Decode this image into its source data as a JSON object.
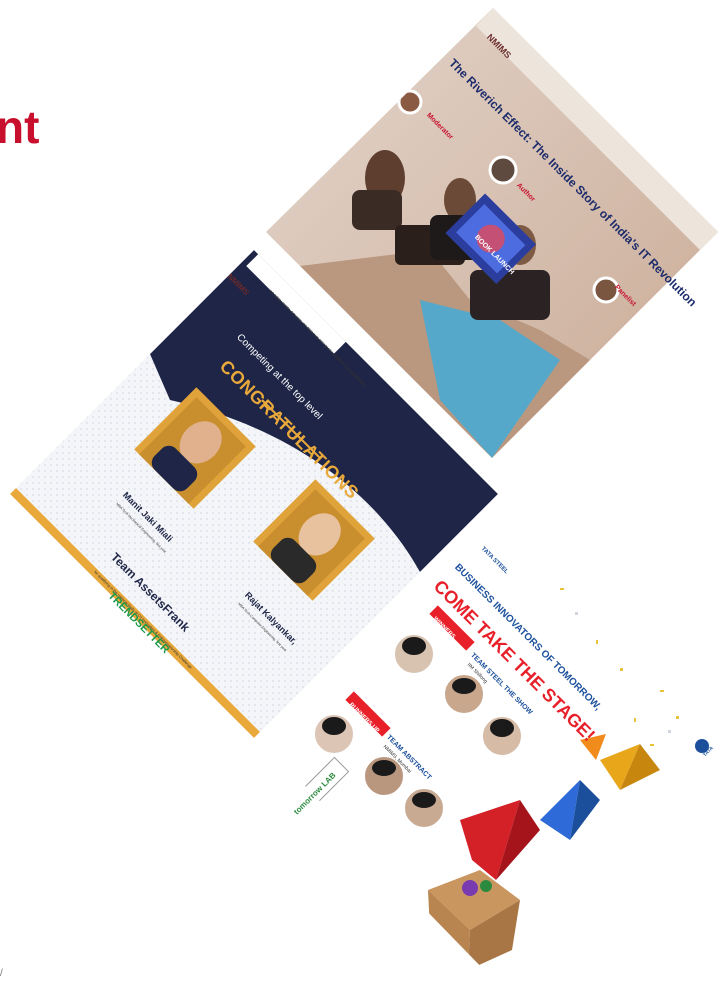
{
  "page": {
    "heading_fragment": "nt",
    "corner_mark": "/"
  },
  "colors": {
    "heading_red": "#c8102e",
    "stage_backdrop": "#c9a994",
    "congrats_navy": "#1e2547",
    "congrats_gold": "#e8a83a",
    "trendsetter_green": "#1a9a4a",
    "tata_red": "#e8202a",
    "tata_blue": "#1b4f9c"
  },
  "card_event": {
    "logo_text": "NMIMS",
    "title": "The Riverich Effect: The Inside Story of India's IT Revolution",
    "moderator_label": "Moderator",
    "author_label": "Author",
    "panelist_label": "Panelist",
    "screen_text": "BOOK LAUNCH"
  },
  "card_congrats": {
    "logo_text": "NMIMS",
    "school_text": "MUKESH PATEL SCHOOL OF TECHNOLOGY MANAGEMENT & ENGINEERING",
    "kicker": "Competing at the top level",
    "title": "CONGRATULATIONS",
    "person1_name": "Manit Jaki Miali",
    "person1_role": "MBA Tech Mechanical Engineering, first year",
    "person2_name": "Rajat Kalyankar,",
    "person2_role": "MBA Tech Computer Engineering, first year",
    "team_name": "Team AssetsFrank",
    "achievement": "for qualifying in the national finals of CII Innovation & Entrepreneurship Challenge",
    "brand": "TRENDSETTER"
  },
  "card_tata": {
    "brand_small": "TATA STEEL",
    "tagline": "BUSINESS INNOVATORS OF TOMORROW,",
    "headline": "COME TAKE THE STAGE!",
    "badge1": "WINNERS",
    "team1": "TEAM STEEL THE SHOW",
    "team1_college": "IIM Shillong",
    "badge2": "RUNNERS UP",
    "team2": "TEAM ABSTRACT",
    "team2_college": "NMIMS, Mumbai",
    "lab_logo": "tomorrow LAB",
    "corner_logo": "TATA"
  }
}
